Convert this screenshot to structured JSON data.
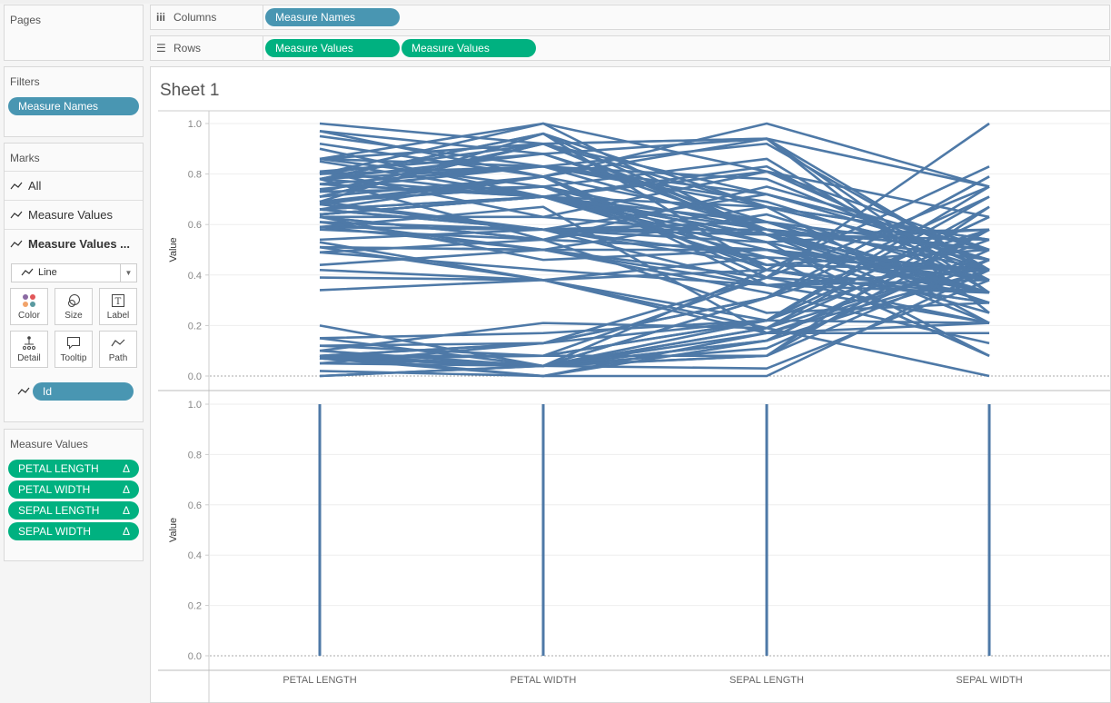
{
  "pages": {
    "title": "Pages"
  },
  "shelves": {
    "columns_label": "Columns",
    "rows_label": "Rows",
    "columns": [
      "Measure Names"
    ],
    "rows": [
      "Measure Values",
      "Measure Values"
    ]
  },
  "filters": {
    "title": "Filters",
    "items": [
      "Measure Names"
    ]
  },
  "marks": {
    "title": "Marks",
    "cards": [
      "All",
      "Measure Values",
      "Measure Values ..."
    ],
    "type": "Line",
    "buttons": [
      "Color",
      "Size",
      "Label",
      "Detail",
      "Tooltip",
      "Path"
    ],
    "path_field": "Id"
  },
  "measure_values": {
    "title": "Measure Values",
    "items": [
      "PETAL LENGTH",
      "PETAL WIDTH",
      "SEPAL LENGTH",
      "SEPAL WIDTH"
    ],
    "delta": "Δ"
  },
  "sheet": {
    "title": "Sheet 1"
  },
  "colors": {
    "line": "#4e79a7",
    "blue_pill": "#4996b2",
    "green_pill": "#00b180"
  },
  "chart_data": [
    {
      "type": "line",
      "pane": "top",
      "ylabel": "Value",
      "ylim": [
        0,
        1
      ],
      "yticks": [
        "0.0",
        "0.2",
        "0.4",
        "0.6",
        "0.8",
        "1.0"
      ],
      "categories": [
        "PETAL LENGTH",
        "PETAL WIDTH",
        "SEPAL LENGTH",
        "SEPAL WIDTH"
      ],
      "series": [
        [
          0.07,
          0.04,
          0.22,
          0.63
        ],
        [
          0.07,
          0.04,
          0.17,
          0.42
        ],
        [
          0.05,
          0.04,
          0.11,
          0.5
        ],
        [
          0.08,
          0.04,
          0.08,
          0.46
        ],
        [
          0.07,
          0.04,
          0.19,
          0.67
        ],
        [
          0.12,
          0.13,
          0.31,
          0.79
        ],
        [
          0.07,
          0.08,
          0.08,
          0.58
        ],
        [
          0.08,
          0.04,
          0.19,
          0.58
        ],
        [
          0.07,
          0.04,
          0.03,
          0.38
        ],
        [
          0.08,
          0.0,
          0.17,
          0.46
        ],
        [
          0.08,
          0.04,
          0.31,
          0.71
        ],
        [
          0.1,
          0.04,
          0.14,
          0.58
        ],
        [
          0.07,
          0.0,
          0.14,
          0.42
        ],
        [
          0.02,
          0.0,
          0.0,
          0.42
        ],
        [
          0.0,
          0.04,
          0.42,
          0.83
        ],
        [
          0.08,
          0.13,
          0.39,
          1.0
        ],
        [
          0.05,
          0.13,
          0.31,
          0.79
        ],
        [
          0.07,
          0.08,
          0.22,
          0.63
        ],
        [
          0.12,
          0.08,
          0.39,
          0.75
        ],
        [
          0.08,
          0.08,
          0.22,
          0.75
        ],
        [
          0.15,
          0.04,
          0.31,
          0.58
        ],
        [
          0.08,
          0.13,
          0.22,
          0.71
        ],
        [
          0.0,
          0.04,
          0.08,
          0.67
        ],
        [
          0.15,
          0.17,
          0.22,
          0.54
        ],
        [
          0.2,
          0.04,
          0.14,
          0.58
        ],
        [
          0.1,
          0.21,
          0.19,
          0.46
        ],
        [
          0.63,
          0.54,
          0.75,
          0.5
        ],
        [
          0.59,
          0.58,
          0.58,
          0.5
        ],
        [
          0.66,
          0.58,
          0.72,
          0.46
        ],
        [
          0.51,
          0.5,
          0.33,
          0.13
        ],
        [
          0.61,
          0.58,
          0.61,
          0.33
        ],
        [
          0.59,
          0.5,
          0.39,
          0.33
        ],
        [
          0.63,
          0.63,
          0.56,
          0.54
        ],
        [
          0.39,
          0.38,
          0.17,
          0.17
        ],
        [
          0.61,
          0.5,
          0.64,
          0.38
        ],
        [
          0.49,
          0.54,
          0.25,
          0.29
        ],
        [
          0.42,
          0.38,
          0.19,
          0.0
        ],
        [
          0.54,
          0.58,
          0.44,
          0.42
        ],
        [
          0.51,
          0.38,
          0.47,
          0.08
        ],
        [
          0.63,
          0.54,
          0.5,
          0.38
        ],
        [
          0.44,
          0.5,
          0.36,
          0.38
        ],
        [
          0.58,
          0.54,
          0.67,
          0.46
        ],
        [
          0.59,
          0.58,
          0.36,
          0.42
        ],
        [
          0.53,
          0.38,
          0.42,
          0.29
        ],
        [
          0.59,
          0.58,
          0.53,
          0.08
        ],
        [
          0.49,
          0.42,
          0.36,
          0.21
        ],
        [
          0.64,
          0.71,
          0.44,
          0.5
        ],
        [
          0.51,
          0.5,
          0.5,
          0.33
        ],
        [
          0.66,
          0.58,
          0.56,
          0.21
        ],
        [
          0.63,
          0.46,
          0.5,
          0.33
        ],
        [
          0.34,
          0.38,
          0.22,
          0.21
        ],
        [
          0.8,
          1.0,
          0.56,
          0.54
        ],
        [
          0.69,
          0.75,
          0.42,
          0.29
        ],
        [
          0.86,
          0.83,
          0.78,
          0.42
        ],
        [
          0.78,
          0.71,
          0.56,
          0.38
        ],
        [
          0.81,
          0.88,
          0.61,
          0.42
        ],
        [
          0.95,
          0.83,
          0.92,
          0.42
        ],
        [
          0.59,
          0.67,
          0.17,
          0.21
        ],
        [
          0.9,
          0.71,
          0.83,
          0.38
        ],
        [
          0.81,
          0.71,
          0.67,
          0.21
        ],
        [
          0.86,
          1.0,
          0.81,
          0.63
        ],
        [
          0.69,
          0.79,
          0.61,
          0.5
        ],
        [
          0.73,
          0.75,
          0.58,
          0.29
        ],
        [
          0.76,
          0.83,
          0.69,
          0.42
        ],
        [
          0.68,
          0.79,
          0.39,
          0.21
        ],
        [
          0.69,
          0.96,
          0.42,
          0.33
        ],
        [
          0.73,
          0.92,
          0.58,
          0.5
        ],
        [
          0.76,
          0.71,
          0.61,
          0.42
        ],
        [
          0.97,
          0.88,
          0.94,
          0.75
        ],
        [
          1.0,
          0.92,
          0.94,
          0.25
        ],
        [
          0.68,
          0.58,
          0.47,
          0.08
        ],
        [
          0.8,
          0.92,
          0.72,
          0.5
        ],
        [
          0.66,
          0.79,
          0.36,
          0.33
        ],
        [
          0.97,
          0.79,
          0.94,
          0.33
        ],
        [
          0.66,
          0.71,
          0.56,
          0.29
        ],
        [
          0.8,
          0.83,
          0.67,
          0.54
        ],
        [
          0.85,
          0.71,
          0.81,
          0.5
        ],
        [
          0.64,
          0.71,
          0.53,
          0.33
        ],
        [
          0.66,
          0.71,
          0.5,
          0.42
        ],
        [
          0.78,
          0.83,
          0.58,
          0.33
        ],
        [
          0.81,
          0.63,
          0.81,
          0.42
        ],
        [
          0.86,
          0.75,
          0.86,
          0.33
        ],
        [
          0.92,
          0.79,
          1.0,
          0.75
        ],
        [
          0.78,
          0.88,
          0.58,
          0.33
        ],
        [
          0.69,
          0.58,
          0.56,
          0.33
        ],
        [
          0.78,
          0.54,
          0.5,
          0.25
        ],
        [
          0.86,
          0.92,
          0.94,
          0.42
        ],
        [
          0.78,
          0.96,
          0.56,
          0.58
        ],
        [
          0.76,
          0.71,
          0.58,
          0.46
        ],
        [
          0.64,
          0.71,
          0.47,
          0.42
        ],
        [
          0.74,
          0.83,
          0.72,
          0.46
        ],
        [
          0.71,
          0.92,
          0.67,
          0.46
        ],
        [
          0.71,
          0.92,
          0.56,
          0.38
        ],
        [
          0.78,
          0.96,
          0.67,
          0.54
        ],
        [
          0.69,
          0.75,
          0.53,
          0.58
        ],
        [
          0.71,
          0.79,
          0.44,
          0.42
        ]
      ]
    },
    {
      "type": "line",
      "pane": "bottom",
      "ylabel": "Value",
      "ylim": [
        0,
        1
      ],
      "yticks": [
        "0.0",
        "0.2",
        "0.4",
        "0.6",
        "0.8",
        "1.0"
      ],
      "categories": [
        "PETAL LENGTH",
        "PETAL WIDTH",
        "SEPAL LENGTH",
        "SEPAL WIDTH"
      ],
      "range_min": [
        0,
        0,
        0,
        0
      ],
      "range_max": [
        1,
        1,
        1,
        1
      ]
    }
  ]
}
